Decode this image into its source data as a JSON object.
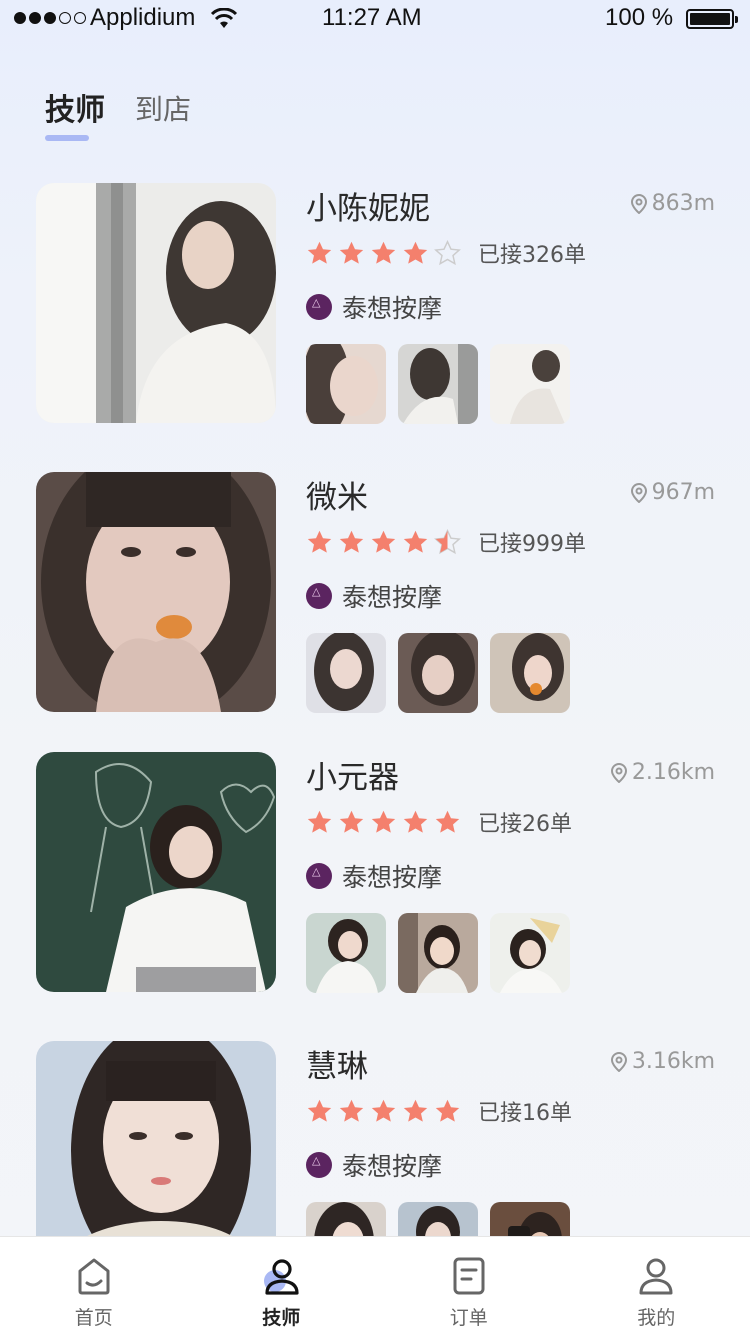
{
  "status_bar": {
    "carrier": "Applidium",
    "time": "11:27 AM",
    "battery": "100 %"
  },
  "tabs": [
    {
      "label": "技师",
      "active": true
    },
    {
      "label": "到店",
      "active": false
    }
  ],
  "technicians": [
    {
      "name": "小陈妮妮",
      "distance": "863m",
      "rating": 4,
      "orders": "已接326单",
      "shop": "泰想按摩"
    },
    {
      "name": "微米",
      "distance": "967m",
      "rating": 4.5,
      "orders": "已接999单",
      "shop": "泰想按摩"
    },
    {
      "name": "小元器",
      "distance": "2.16km",
      "rating": 5,
      "orders": "已接26单",
      "shop": "泰想按摩"
    },
    {
      "name": "慧琳",
      "distance": "3.16km",
      "rating": 5,
      "orders": "已接16单",
      "shop": "泰想按摩"
    }
  ],
  "bottom_nav": [
    {
      "label": "首页",
      "icon": "home-icon"
    },
    {
      "label": "技师",
      "icon": "technician-icon"
    },
    {
      "label": "订单",
      "icon": "order-icon"
    },
    {
      "label": "我的",
      "icon": "profile-icon"
    }
  ],
  "colors": {
    "star_filled": "#f4806d",
    "star_empty": "#cccccc",
    "accent_underline": "#a9b8f4",
    "shop_logo": "#5b2460"
  }
}
